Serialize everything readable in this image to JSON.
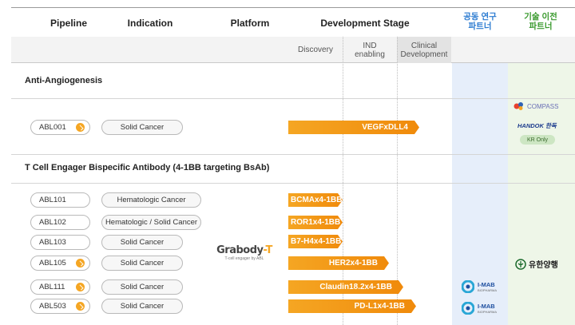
{
  "header": {
    "pipeline": "Pipeline",
    "indication": "Indication",
    "platform": "Platform",
    "development_stage": "Development Stage",
    "co_research": "공동 연구\n파트너",
    "tech_transfer": "기술 이전\n파트너",
    "stages": [
      "Discovery",
      "IND\nenabling",
      "Clinical\nDevelopment"
    ]
  },
  "sections": [
    {
      "title": "Anti-Angiogenesis",
      "rows": [
        {
          "id": "ABL001",
          "indication": "Solid Cancer",
          "bar": "VEGFxDLL4",
          "progress": 0.9,
          "has_marker": true
        }
      ],
      "partners": {
        "tech_transfer": [
          "COMPASS",
          "HANDOK 한독",
          "KR Only"
        ]
      }
    },
    {
      "title": "T Cell Engager Bispecific Antibody (4-1BB targeting BsAb)",
      "platform": "Grabody-T",
      "platform_sub": "T-cell engager by ABL",
      "rows": [
        {
          "id": "ABL101",
          "indication": "Hematologic Cancer",
          "bar": "BCMAx4-1BB",
          "has_marker": false
        },
        {
          "id": "ABL102",
          "indication": "Hematologic / Solid Cancer",
          "bar": "ROR1x4-1BB",
          "has_marker": false
        },
        {
          "id": "ABL103",
          "indication": "Solid Cancer",
          "bar": "B7-H4x4-1BB",
          "has_marker": false
        },
        {
          "id": "ABL105",
          "indication": "Solid Cancer",
          "bar": "HER2x4-1BB",
          "has_marker": true
        },
        {
          "id": "ABL111",
          "indication": "Solid Cancer",
          "bar": "Claudin18.2x4-1BB",
          "has_marker": true
        },
        {
          "id": "ABL503",
          "indication": "Solid Cancer",
          "bar": "PD-L1x4-1BB",
          "has_marker": true
        }
      ],
      "partners": {
        "co_research": [
          "I-MAB",
          "I-MAB"
        ],
        "co_research_sub": "BIOPHARMA",
        "tech_transfer": [
          "유한양행"
        ]
      }
    }
  ],
  "colors": {
    "accent": "#f5a623",
    "partner_blue": "#e6eefa",
    "partner_green": "#eef6e8"
  }
}
